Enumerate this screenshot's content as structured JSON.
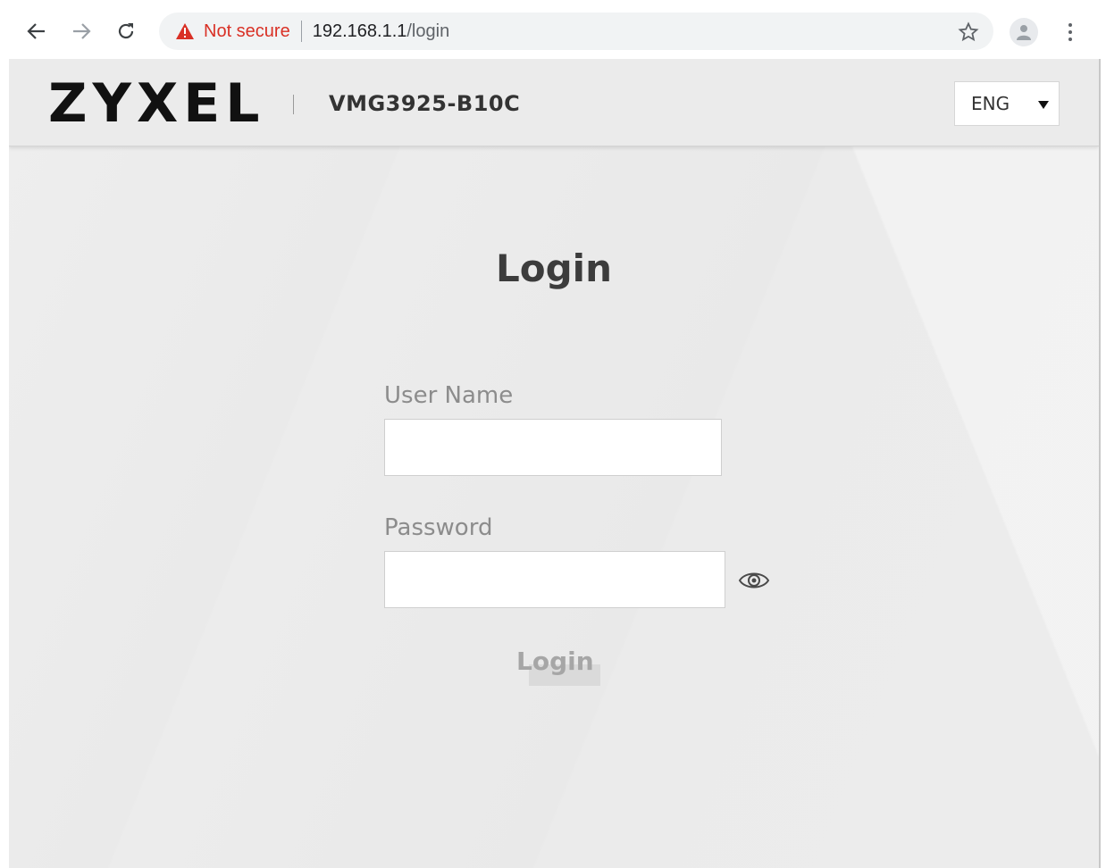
{
  "browser": {
    "security_label": "Not secure",
    "url_host": "192.168.1.1",
    "url_path": "/login"
  },
  "header": {
    "brand": "ZYXEL",
    "model": "VMG3925-B10C",
    "language": "ENG"
  },
  "login": {
    "title": "Login",
    "username_label": "User Name",
    "username_value": "",
    "password_label": "Password",
    "password_value": "",
    "button_label": "Login"
  },
  "colors": {
    "warning": "#d93025",
    "page_background": "#ececec",
    "header_background": "#ebebeb",
    "title_text": "#3c3c3c",
    "label_text": "#8c8c8c",
    "button_text": "#a6a6a6"
  }
}
